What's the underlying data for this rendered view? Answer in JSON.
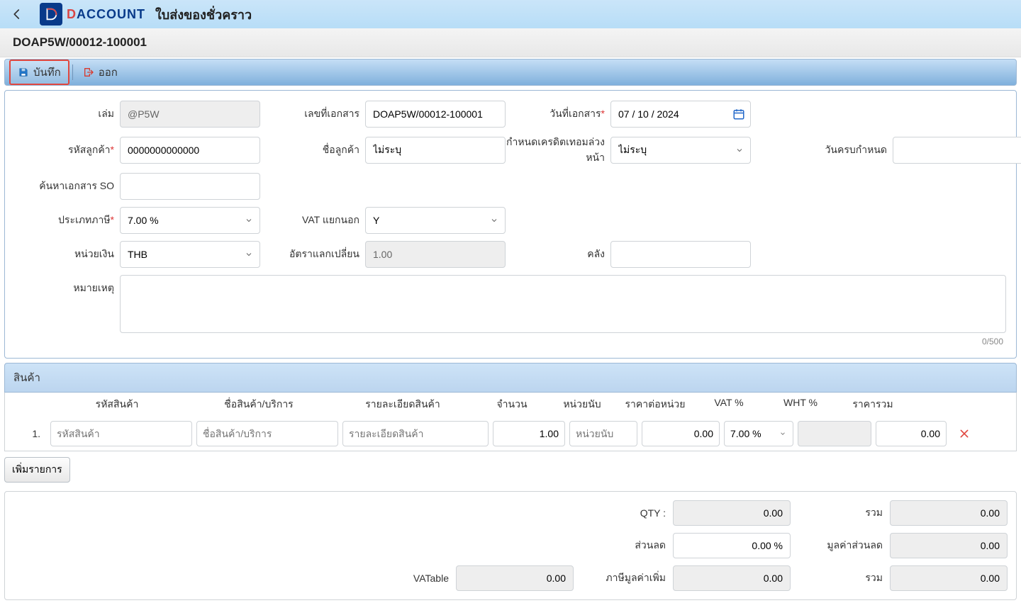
{
  "brand": {
    "d": "D",
    "rest": "ACCOUNT"
  },
  "page_title": "ใบส่งของชั่วคราว",
  "doc_number": "DOAP5W/00012-100001",
  "toolbar": {
    "save": "บันทึก",
    "exit": "ออก"
  },
  "form": {
    "book_label": "เล่ม",
    "book_value": "@P5W",
    "docno_label": "เลขที่เอกสาร",
    "docno_value": "DOAP5W/00012-100001",
    "docdate_label": "วันที่เอกสาร",
    "docdate_value": "07 / 10 / 2024",
    "custcode_label": "รหัสลูกค้า",
    "custcode_value": "0000000000000",
    "custname_label": "ชื่อลูกค้า",
    "custname_value": "ไม่ระบุ",
    "creditterm_label": "กำหนดเครดิตเทอมล่วงหน้า",
    "creditterm_value": "ไม่ระบุ",
    "duedate_label": "วันครบกำหนด",
    "duedate_value": "",
    "findso_label": "ค้นหาเอกสาร SO",
    "findso_value": "",
    "taxtype_label": "ประเภทภาษี",
    "taxtype_value": "7.00 %",
    "vatexcl_label": "VAT แยกนอก",
    "vatexcl_value": "Y",
    "currency_label": "หน่วยเงิน",
    "currency_value": "THB",
    "exchrate_label": "อัตราแลกเปลี่ยน",
    "exchrate_value": "1.00",
    "warehouse_label": "คลัง",
    "warehouse_value": "",
    "remark_label": "หมายเหตุ",
    "remark_value": "",
    "char_count": "0/500"
  },
  "items": {
    "section_title": "สินค้า",
    "headers": {
      "code": "รหัสสินค้า",
      "name": "ชื่อสินค้า/บริการ",
      "detail": "รายละเอียดสินค้า",
      "qty": "จำนวน",
      "unit": "หน่วยนับ",
      "price": "ราคาต่อหน่วย",
      "vat": "VAT %",
      "wht": "WHT %",
      "total": "ราคารวม"
    },
    "rows": [
      {
        "num": "1.",
        "code_ph": "รหัสสินค้า",
        "name_ph": "ชื่อสินค้า/บริการ",
        "detail_ph": "รายละเอียดสินค้า",
        "qty": "1.00",
        "unit_ph": "หน่วยนับ",
        "price": "0.00",
        "vat": "7.00 %",
        "wht": "",
        "total": "0.00"
      }
    ],
    "add_row": "เพิ่มรายการ"
  },
  "summary": {
    "qty_label": "QTY :",
    "qty": "0.00",
    "sum1_label": "รวม",
    "sum1": "0.00",
    "discount_label": "ส่วนลด",
    "discount": "0.00 %",
    "discount_amt_label": "มูลค่าส่วนลด",
    "discount_amt": "0.00",
    "vatable_label": "VATable",
    "vatable": "0.00",
    "vat_label": "ภาษีมูลค่าเพิ่ม",
    "vat": "0.00",
    "sum2_label": "รวม",
    "sum2": "0.00"
  }
}
